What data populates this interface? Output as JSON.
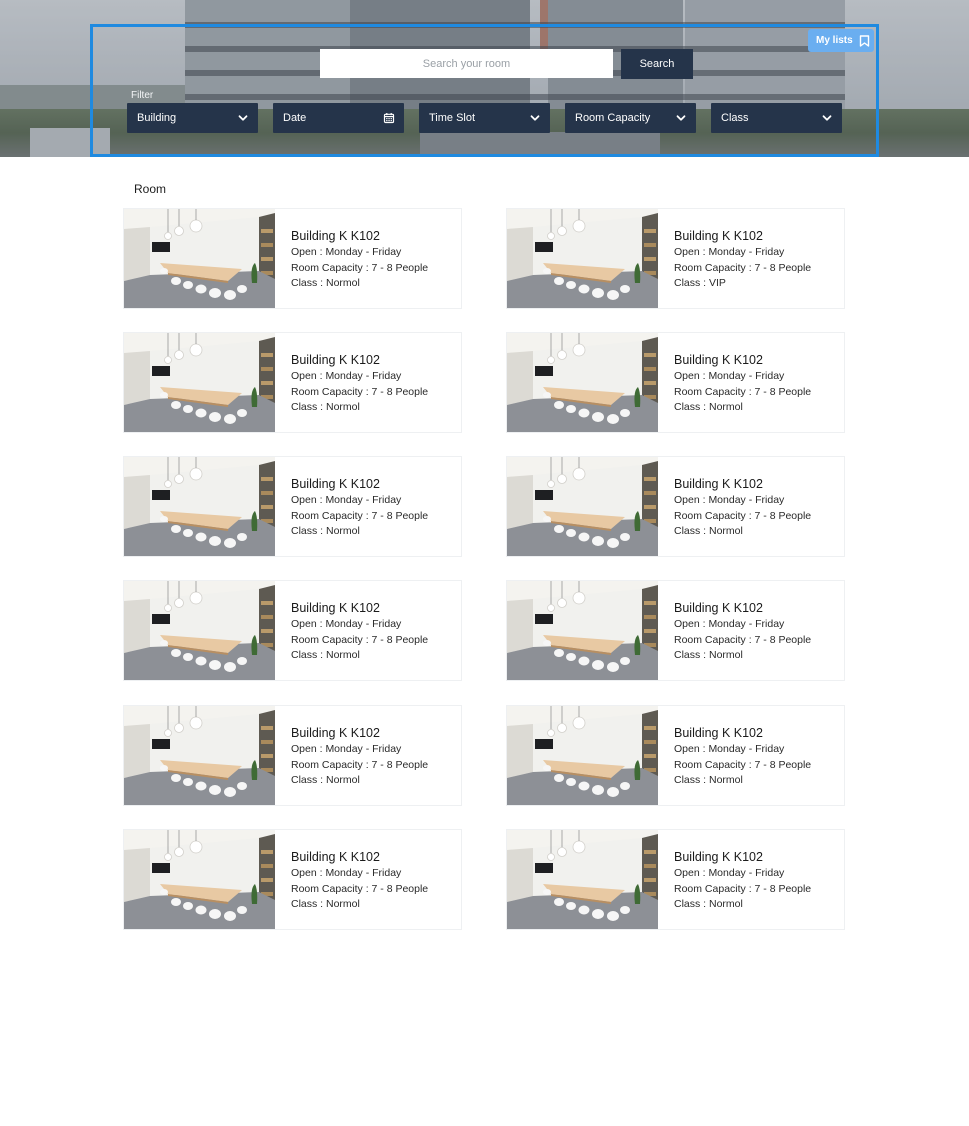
{
  "header": {
    "my_lists_label": "My lists",
    "search": {
      "placeholder": "Search your room",
      "value": "",
      "button_label": "Search"
    },
    "filter_label": "Filter",
    "filters": [
      {
        "label": "Building",
        "icon": "chevron-down-icon"
      },
      {
        "label": "Date",
        "icon": "calendar-icon"
      },
      {
        "label": "Time Slot",
        "icon": "chevron-down-icon"
      },
      {
        "label": "Room Capacity",
        "icon": "chevron-down-icon"
      },
      {
        "label": "Class",
        "icon": "chevron-down-icon"
      }
    ]
  },
  "colors": {
    "panel_border": "#1f8ae0",
    "control_bg": "#25344a",
    "my_lists_bg": "#6aaef0"
  },
  "rooms": {
    "title": "Room",
    "items": [
      {
        "name": "Building K K102",
        "open": "Open : Monday - Friday",
        "capacity": "Room Capacity : 7 - 8 People",
        "class": "Class : Normol"
      },
      {
        "name": "Building K K102",
        "open": "Open : Monday - Friday",
        "capacity": "Room Capacity : 7 - 8 People",
        "class": "Class : VIP"
      },
      {
        "name": "Building K K102",
        "open": "Open : Monday - Friday",
        "capacity": "Room Capacity : 7 - 8 People",
        "class": "Class : Normol"
      },
      {
        "name": "Building K K102",
        "open": "Open : Monday - Friday",
        "capacity": "Room Capacity : 7 - 8 People",
        "class": "Class : Normol"
      },
      {
        "name": "Building K K102",
        "open": "Open : Monday - Friday",
        "capacity": "Room Capacity : 7 - 8 People",
        "class": "Class : Normol"
      },
      {
        "name": "Building K K102",
        "open": "Open : Monday - Friday",
        "capacity": "Room Capacity : 7 - 8 People",
        "class": "Class : Normol"
      },
      {
        "name": "Building K K102",
        "open": "Open : Monday - Friday",
        "capacity": "Room Capacity : 7 - 8 People",
        "class": "Class : Normol"
      },
      {
        "name": "Building K K102",
        "open": "Open : Monday - Friday",
        "capacity": "Room Capacity : 7 - 8 People",
        "class": "Class : Normol"
      },
      {
        "name": "Building K K102",
        "open": "Open : Monday - Friday",
        "capacity": "Room Capacity : 7 - 8 People",
        "class": "Class : Normol"
      },
      {
        "name": "Building K K102",
        "open": "Open : Monday - Friday",
        "capacity": "Room Capacity : 7 - 8 People",
        "class": "Class : Normol"
      },
      {
        "name": "Building K K102",
        "open": "Open : Monday - Friday",
        "capacity": "Room Capacity : 7 - 8 People",
        "class": "Class : Normol"
      },
      {
        "name": "Building K K102",
        "open": "Open : Monday - Friday",
        "capacity": "Room Capacity : 7 - 8 People",
        "class": "Class : Normol"
      }
    ]
  }
}
